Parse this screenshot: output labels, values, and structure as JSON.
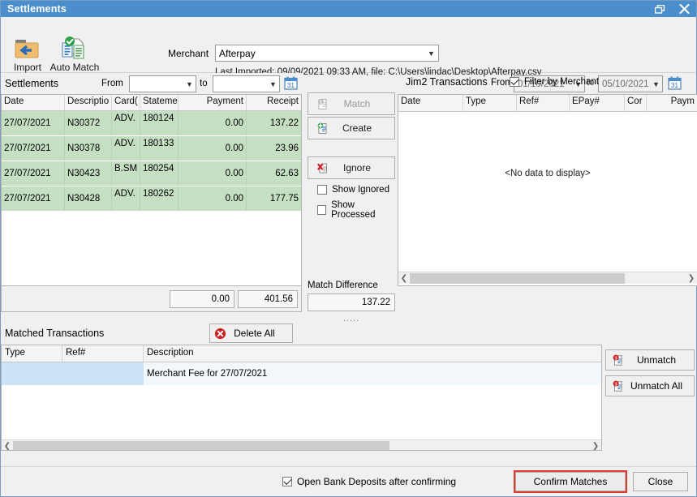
{
  "window": {
    "title": "Settlements",
    "restore_icon": "restore-window-icon",
    "close_icon": "close-window-icon"
  },
  "toolbar": {
    "import_label": "Import",
    "auto_match_label": "Auto Match",
    "merchant_label": "Merchant",
    "merchant_value": "Afterpay",
    "last_imported": "Last Imported: 09/09/2021 09:33 AM, file: C:\\Users\\lindac\\Desktop\\Afterpay.csv"
  },
  "settlements": {
    "title": "Settlements",
    "from_label": "From",
    "from_value": "",
    "to_label": "to",
    "to_value": "",
    "calendar_icon": "calendar-icon",
    "columns": [
      "Date",
      "Descriptio",
      "Card(",
      "Stateme",
      "Payment",
      "Receipt"
    ],
    "rows": [
      {
        "date": "27/07/2021",
        "description": "N30372",
        "card": "ADV.",
        "statement": "180124",
        "payment": "0.00",
        "receipt": "137.22"
      },
      {
        "date": "27/07/2021",
        "description": "N30378",
        "card": "ADV.",
        "statement": "180133",
        "payment": "0.00",
        "receipt": "23.96"
      },
      {
        "date": "27/07/2021",
        "description": "N30423",
        "card": "B.SM",
        "statement": "180254",
        "payment": "0.00",
        "receipt": "62.63"
      },
      {
        "date": "27/07/2021",
        "description": "N30428",
        "card": "ADV.",
        "statement": "180262",
        "payment": "0.00",
        "receipt": "177.75"
      }
    ],
    "total_payment": "0.00",
    "total_receipt": "401.56"
  },
  "actions": {
    "match_label": "Match",
    "match_icon": "match-document-icon",
    "create_label": "Create",
    "create_icon": "create-document-icon",
    "ignore_label": "Ignore",
    "ignore_icon": "ignore-document-icon",
    "show_ignored_label": "Show Ignored",
    "show_ignored_checked": false,
    "show_processed_label": "Show Processed",
    "show_processed_checked": false,
    "match_difference_label": "Match Difference",
    "match_difference_value": "137.22",
    "resize_dots": "....."
  },
  "jim2": {
    "title": "Jim2 Transactions",
    "from_label": "From",
    "from_value": "01/10/2021",
    "to_label": "to",
    "to_value": "05/10/2021",
    "filter_by_merchant_label": "Filter by Merchant",
    "filter_by_merchant_checked": true,
    "calendar_icon": "calendar-icon",
    "columns": [
      "Date",
      "Type",
      "Ref#",
      "EPay#",
      "Cor",
      "Paym"
    ],
    "empty_text": "<No data to display>"
  },
  "matched": {
    "title": "Matched Transactions",
    "delete_all_label": "Delete All",
    "delete_all_icon": "delete-circle-icon",
    "columns": [
      "Type",
      "Ref#",
      "Description"
    ],
    "rows": [
      {
        "type": "",
        "ref": "",
        "description": "Merchant Fee for 27/07/2021"
      }
    ],
    "unmatch_label": "Unmatch",
    "unmatch_icon": "unmatch-document-icon",
    "unmatch_all_label": "Unmatch All",
    "unmatch_all_icon": "unmatch-document-icon"
  },
  "footer": {
    "open_bank_deposits_label": "Open Bank Deposits after confirming",
    "open_bank_deposits_checked": true,
    "confirm_label": "Confirm Matches",
    "close_label": "Close",
    "highlight_color": "#e03a2f"
  }
}
